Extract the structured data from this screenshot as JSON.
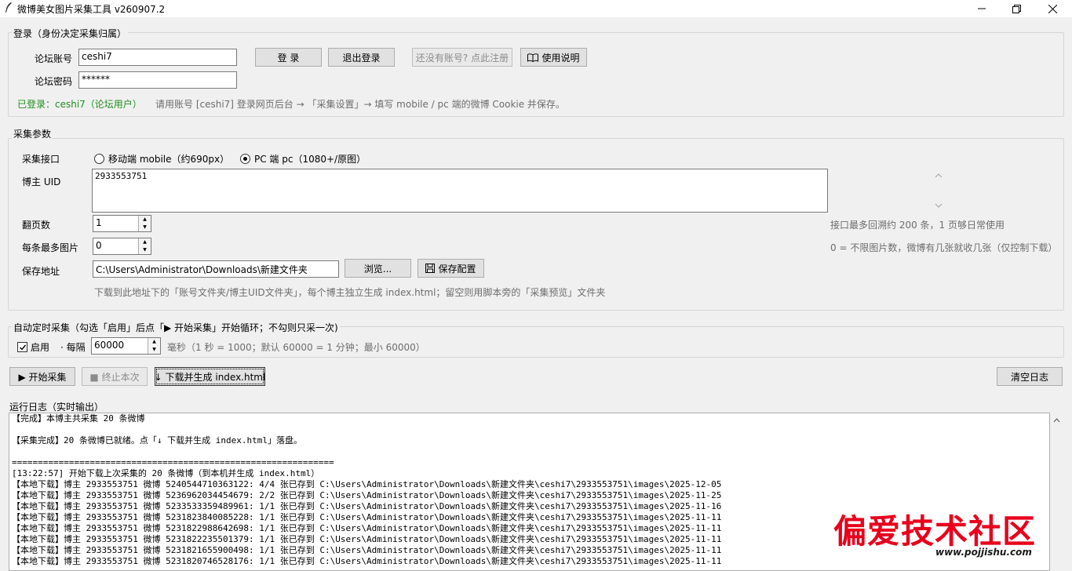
{
  "window": {
    "title": "微博美女图片采集工具 v260907.2"
  },
  "login": {
    "group_title": "登录（身份决定采集归属）",
    "account_label": "论坛账号",
    "account_value": "ceshi7",
    "password_label": "论坛密码",
    "password_value": "******",
    "login_btn": "登 录",
    "logout_btn": "退出登录",
    "register_btn": "还没有账号? 点此注册",
    "help_btn": "使用说明",
    "status": "已登录：ceshi7（论坛用户）",
    "hint": "请用账号 [ceshi7] 登录网页后台 → 「采集设置」→ 填写 mobile / pc 端的微博 Cookie 并保存。"
  },
  "params": {
    "group_title": "采集参数",
    "api_label": "采集接口",
    "api_mobile": "移动端 mobile（约690px）",
    "api_pc": "PC 端 pc（1080+/原图）",
    "api_selected": "pc",
    "uid_label": "博主 UID",
    "uid_value": "2933553751",
    "pages_label": "翻页数",
    "pages_value": "1",
    "pages_hint": "接口最多回溯约 200 条，1 页够日常使用",
    "maximg_label": "每条最多图片",
    "maximg_value": "0",
    "maximg_hint": "0 = 不限图片数，微博有几张就收几张（仅控制下载）",
    "save_label": "保存地址",
    "save_value": "C:\\Users\\Administrator\\Downloads\\新建文件夹",
    "browse_btn": "浏览...",
    "saveconf_btn": "保存配置",
    "save_hint": "下载到此地址下的「账号文件夹/博主UID文件夹」，每个博主独立生成 index.html；留空则用脚本旁的「采集预览」文件夹"
  },
  "timer": {
    "group_title": "自动定时采集（勾选「启用」后点「▶ 开始采集」开始循环；不勾则只采一次)",
    "enable_label": "启用",
    "enabled": true,
    "every_label": "· 每隔",
    "interval_value": "60000",
    "interval_hint": "毫秒（1 秒 = 1000；默认 60000 = 1 分钟；最小 60000）"
  },
  "actions": {
    "start_btn": "▶ 开始采集",
    "stop_btn": "■ 终止本次",
    "download_btn": "↓ 下载并生成 index.html",
    "clear_btn": "清空日志"
  },
  "log": {
    "title": "运行日志（实时输出）",
    "lines": [
      "【完成】本博主共采集 20 条微博",
      "",
      "【采集完成】20 条微博已就绪。点「↓ 下载并生成 index.html」落盘。",
      "",
      "==============================================================",
      "[13:22:57] 开始下载上次采集的 20 条微博（到本机并生成 index.html）",
      "【本地下载】博主 2933553751 微博 5240544710363122: 4/4 张已存到 C:\\Users\\Administrator\\Downloads\\新建文件夹\\ceshi7\\2933553751\\images\\2025-12-05",
      "【本地下载】博主 2933553751 微博 5236962034454679: 2/2 张已存到 C:\\Users\\Administrator\\Downloads\\新建文件夹\\ceshi7\\2933553751\\images\\2025-11-25",
      "【本地下载】博主 2933553751 微博 5233533359489961: 1/1 张已存到 C:\\Users\\Administrator\\Downloads\\新建文件夹\\ceshi7\\2933553751\\images\\2025-11-16",
      "【本地下载】博主 2933553751 微博 5231823840085228: 1/1 张已存到 C:\\Users\\Administrator\\Downloads\\新建文件夹\\ceshi7\\2933553751\\images\\2025-11-11",
      "【本地下载】博主 2933553751 微博 5231822988642698: 1/1 张已存到 C:\\Users\\Administrator\\Downloads\\新建文件夹\\ceshi7\\2933553751\\images\\2025-11-11",
      "【本地下载】博主 2933553751 微博 5231822235501379: 1/1 张已存到 C:\\Users\\Administrator\\Downloads\\新建文件夹\\ceshi7\\2933553751\\images\\2025-11-11",
      "【本地下载】博主 2933553751 微博 5231821655900498: 1/1 张已存到 C:\\Users\\Administrator\\Downloads\\新建文件夹\\ceshi7\\2933553751\\images\\2025-11-11",
      "【本地下载】博主 2933553751 微博 5231820746528176: 1/1 张已存到 C:\\Users\\Administrator\\Downloads\\新建文件夹\\ceshi7\\2933553751\\images\\2025-11-11"
    ]
  },
  "watermark": {
    "text": "偏爱技术社区",
    "url": "www.pojjishu.com"
  },
  "colors": {
    "status_green": "#1e8e1e",
    "watermark_red": "#e8001c"
  }
}
